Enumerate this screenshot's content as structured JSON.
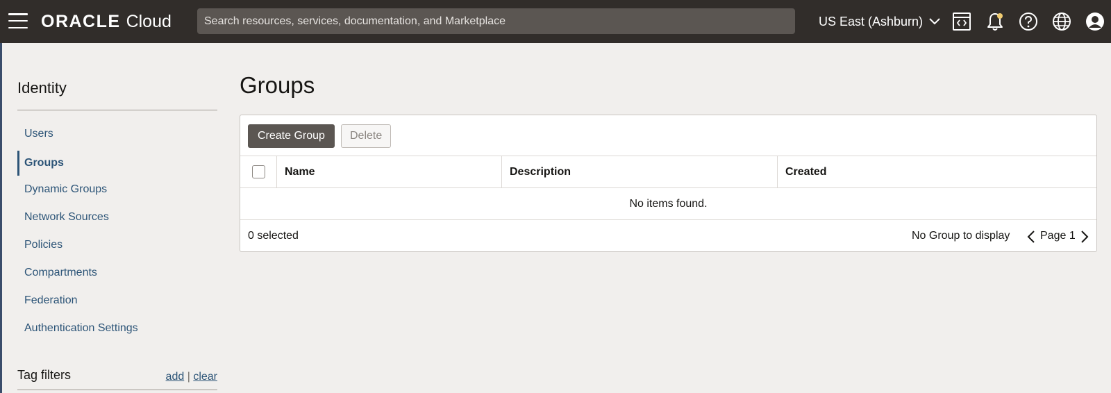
{
  "header": {
    "brand_main": "ORACLE",
    "brand_sub": "Cloud",
    "search_placeholder": "Search resources, services, documentation, and Marketplace",
    "region": "US East (Ashburn)",
    "icons": [
      "menu-icon",
      "code-editor-icon",
      "notification-bell-icon",
      "help-icon",
      "globe-icon",
      "user-avatar-icon"
    ]
  },
  "sidebar": {
    "title": "Identity",
    "items": [
      {
        "label": "Users",
        "active": false
      },
      {
        "label": "Groups",
        "active": true
      },
      {
        "label": "Dynamic Groups",
        "active": false
      },
      {
        "label": "Network Sources",
        "active": false
      },
      {
        "label": "Policies",
        "active": false
      },
      {
        "label": "Compartments",
        "active": false
      },
      {
        "label": "Federation",
        "active": false
      },
      {
        "label": "Authentication Settings",
        "active": false
      }
    ],
    "tag_filters": {
      "title": "Tag filters",
      "add": "add",
      "separator": "|",
      "clear": "clear"
    }
  },
  "main": {
    "title": "Groups",
    "toolbar": {
      "create_label": "Create Group",
      "delete_label": "Delete"
    },
    "table": {
      "columns": [
        "Name",
        "Description",
        "Created"
      ],
      "empty_message": "No items found."
    },
    "footer": {
      "selected": "0 selected",
      "display_text": "No Group to display",
      "page_label": "Page 1"
    }
  },
  "colors": {
    "header_bg": "#312d2a",
    "link": "#2c5477",
    "primary_button": "#5b5652",
    "notification_dot": "#f0cc71"
  }
}
